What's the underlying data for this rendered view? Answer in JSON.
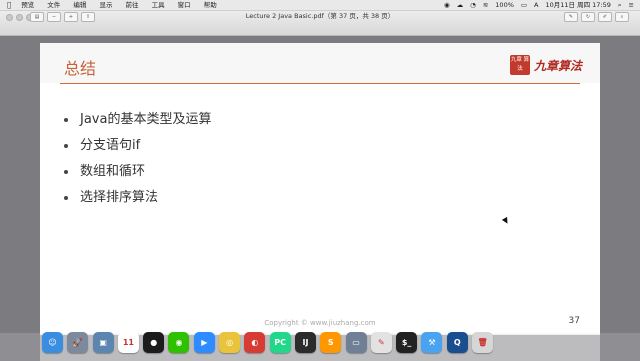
{
  "menubar": {
    "apple": "",
    "items": [
      "预览",
      "文件",
      "编辑",
      "显示",
      "前往",
      "工具",
      "窗口",
      "帮助"
    ],
    "status": {
      "battery": "100%",
      "datetime": "10月11日 周四 17:59",
      "wifi": "",
      "user_menu": "≡"
    }
  },
  "window": {
    "title": "Lecture 2 Java Basic.pdf（第 37 页，共 38 页）"
  },
  "slide": {
    "title": "总结",
    "logo_text": "九章算法",
    "seal_text": "九章 算法",
    "bullets": [
      "Java的基本类型及运算",
      "分支语句if",
      "数组和循环",
      "选择排序算法"
    ],
    "copyright": "Copyright © www.jiuzhang.com",
    "page_number": "37"
  },
  "dock": {
    "apps": [
      {
        "name": "finder-icon",
        "color": "#3a8de0",
        "glyph": "☺"
      },
      {
        "name": "launchpad-icon",
        "color": "#7b8a9c",
        "glyph": "🚀"
      },
      {
        "name": "preview-icon",
        "color": "#5c86b0",
        "glyph": "▣"
      },
      {
        "name": "calendar-icon",
        "color": "#ffffff",
        "glyph": "11"
      },
      {
        "name": "qq-icon",
        "color": "#1c1c1c",
        "glyph": "●"
      },
      {
        "name": "wechat-icon",
        "color": "#2dc100",
        "glyph": "◉"
      },
      {
        "name": "zoom-icon",
        "color": "#2d8cff",
        "glyph": "▶"
      },
      {
        "name": "chrome-icon",
        "color": "#e9c43a",
        "glyph": "◎"
      },
      {
        "name": "netease-music-icon",
        "color": "#d63c33",
        "glyph": "◐"
      },
      {
        "name": "pycharm-icon",
        "color": "#21d789",
        "glyph": "PC"
      },
      {
        "name": "intellij-icon",
        "color": "#2b2b2b",
        "glyph": "IJ"
      },
      {
        "name": "sublime-icon",
        "color": "#ff9800",
        "glyph": "S"
      },
      {
        "name": "screenshot-icon",
        "color": "#6f7f95",
        "glyph": "▭"
      },
      {
        "name": "keynote-icon",
        "color": "#e2e2e2",
        "glyph": "✎"
      },
      {
        "name": "terminal-icon",
        "color": "#222222",
        "glyph": "$_"
      },
      {
        "name": "xcode-icon",
        "color": "#4aa3f0",
        "glyph": "⚒"
      },
      {
        "name": "quicktime-icon",
        "color": "#1a4f8f",
        "glyph": "Q"
      },
      {
        "name": "trash-icon",
        "color": "#d6d6d6",
        "glyph": "🗑"
      }
    ]
  }
}
